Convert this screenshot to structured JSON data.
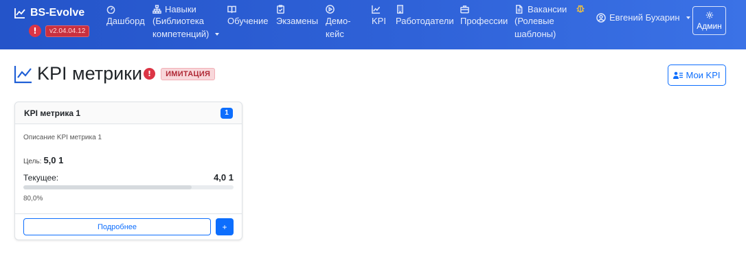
{
  "brand": {
    "name": "BS-Evolve",
    "version": "v2.04.04.12",
    "alert_glyph": "!"
  },
  "nav": [
    {
      "icon": "gauge-icon",
      "lines": [
        "Дашборд"
      ]
    },
    {
      "icon": "sitemap-icon",
      "lines": [
        "Навыки",
        "(Библиотека",
        "компетенций)"
      ],
      "dropdown": true
    },
    {
      "icon": "book-icon",
      "lines": [
        "Обучение"
      ]
    },
    {
      "icon": "clipboard-check-icon",
      "lines": [
        "Экзамены"
      ]
    },
    {
      "icon": "play-circle-icon",
      "lines": [
        "Демо-",
        "кейс"
      ]
    },
    {
      "icon": "chart-line-icon",
      "lines": [
        "KPI"
      ]
    },
    {
      "icon": "building-icon",
      "lines": [
        "Работодатели"
      ]
    },
    {
      "icon": "briefcase-icon",
      "lines": [
        "Профессии"
      ]
    },
    {
      "icon": "file-icon",
      "lines": [
        "Вакансии",
        "(Ролевые",
        "шаблоны)"
      ]
    }
  ],
  "user": {
    "name": "Евгений Бухарин"
  },
  "admin_label": "Админ",
  "page": {
    "title": "KPI метрики",
    "alert_glyph": "!",
    "badge": "ИМИТАЦИЯ",
    "my_kpi_label": "Мои KPI"
  },
  "card": {
    "title": "KPI метрика 1",
    "count": "1",
    "description": "Описание KPI метрика 1",
    "goal_label": "Цель:",
    "goal_value": "5,0 1",
    "current_label": "Текущее:",
    "current_value": "4,0 1",
    "progress_percent": 80,
    "progress_text": "80,0%",
    "details_label": "Подробнее",
    "plus_label": "+"
  },
  "colors": {
    "navbar": "#2f62d8",
    "primary": "#0d6efd",
    "danger": "#dc3545"
  }
}
